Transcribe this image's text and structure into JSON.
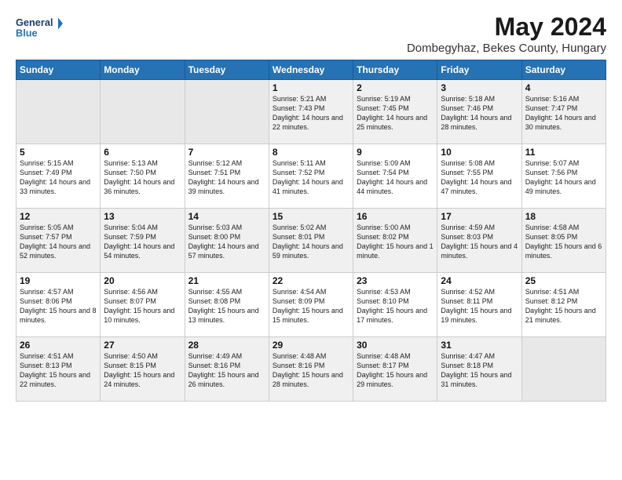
{
  "logo": {
    "line1": "General",
    "line2": "Blue"
  },
  "title": "May 2024",
  "subtitle": "Dombegyhaz, Bekes County, Hungary",
  "weekdays": [
    "Sunday",
    "Monday",
    "Tuesday",
    "Wednesday",
    "Thursday",
    "Friday",
    "Saturday"
  ],
  "weeks": [
    [
      {
        "day": "",
        "sunrise": "",
        "sunset": "",
        "daylight": ""
      },
      {
        "day": "",
        "sunrise": "",
        "sunset": "",
        "daylight": ""
      },
      {
        "day": "",
        "sunrise": "",
        "sunset": "",
        "daylight": ""
      },
      {
        "day": "1",
        "sunrise": "Sunrise: 5:21 AM",
        "sunset": "Sunset: 7:43 PM",
        "daylight": "Daylight: 14 hours and 22 minutes."
      },
      {
        "day": "2",
        "sunrise": "Sunrise: 5:19 AM",
        "sunset": "Sunset: 7:45 PM",
        "daylight": "Daylight: 14 hours and 25 minutes."
      },
      {
        "day": "3",
        "sunrise": "Sunrise: 5:18 AM",
        "sunset": "Sunset: 7:46 PM",
        "daylight": "Daylight: 14 hours and 28 minutes."
      },
      {
        "day": "4",
        "sunrise": "Sunrise: 5:16 AM",
        "sunset": "Sunset: 7:47 PM",
        "daylight": "Daylight: 14 hours and 30 minutes."
      }
    ],
    [
      {
        "day": "5",
        "sunrise": "Sunrise: 5:15 AM",
        "sunset": "Sunset: 7:49 PM",
        "daylight": "Daylight: 14 hours and 33 minutes."
      },
      {
        "day": "6",
        "sunrise": "Sunrise: 5:13 AM",
        "sunset": "Sunset: 7:50 PM",
        "daylight": "Daylight: 14 hours and 36 minutes."
      },
      {
        "day": "7",
        "sunrise": "Sunrise: 5:12 AM",
        "sunset": "Sunset: 7:51 PM",
        "daylight": "Daylight: 14 hours and 39 minutes."
      },
      {
        "day": "8",
        "sunrise": "Sunrise: 5:11 AM",
        "sunset": "Sunset: 7:52 PM",
        "daylight": "Daylight: 14 hours and 41 minutes."
      },
      {
        "day": "9",
        "sunrise": "Sunrise: 5:09 AM",
        "sunset": "Sunset: 7:54 PM",
        "daylight": "Daylight: 14 hours and 44 minutes."
      },
      {
        "day": "10",
        "sunrise": "Sunrise: 5:08 AM",
        "sunset": "Sunset: 7:55 PM",
        "daylight": "Daylight: 14 hours and 47 minutes."
      },
      {
        "day": "11",
        "sunrise": "Sunrise: 5:07 AM",
        "sunset": "Sunset: 7:56 PM",
        "daylight": "Daylight: 14 hours and 49 minutes."
      }
    ],
    [
      {
        "day": "12",
        "sunrise": "Sunrise: 5:05 AM",
        "sunset": "Sunset: 7:57 PM",
        "daylight": "Daylight: 14 hours and 52 minutes."
      },
      {
        "day": "13",
        "sunrise": "Sunrise: 5:04 AM",
        "sunset": "Sunset: 7:59 PM",
        "daylight": "Daylight: 14 hours and 54 minutes."
      },
      {
        "day": "14",
        "sunrise": "Sunrise: 5:03 AM",
        "sunset": "Sunset: 8:00 PM",
        "daylight": "Daylight: 14 hours and 57 minutes."
      },
      {
        "day": "15",
        "sunrise": "Sunrise: 5:02 AM",
        "sunset": "Sunset: 8:01 PM",
        "daylight": "Daylight: 14 hours and 59 minutes."
      },
      {
        "day": "16",
        "sunrise": "Sunrise: 5:00 AM",
        "sunset": "Sunset: 8:02 PM",
        "daylight": "Daylight: 15 hours and 1 minute."
      },
      {
        "day": "17",
        "sunrise": "Sunrise: 4:59 AM",
        "sunset": "Sunset: 8:03 PM",
        "daylight": "Daylight: 15 hours and 4 minutes."
      },
      {
        "day": "18",
        "sunrise": "Sunrise: 4:58 AM",
        "sunset": "Sunset: 8:05 PM",
        "daylight": "Daylight: 15 hours and 6 minutes."
      }
    ],
    [
      {
        "day": "19",
        "sunrise": "Sunrise: 4:57 AM",
        "sunset": "Sunset: 8:06 PM",
        "daylight": "Daylight: 15 hours and 8 minutes."
      },
      {
        "day": "20",
        "sunrise": "Sunrise: 4:56 AM",
        "sunset": "Sunset: 8:07 PM",
        "daylight": "Daylight: 15 hours and 10 minutes."
      },
      {
        "day": "21",
        "sunrise": "Sunrise: 4:55 AM",
        "sunset": "Sunset: 8:08 PM",
        "daylight": "Daylight: 15 hours and 13 minutes."
      },
      {
        "day": "22",
        "sunrise": "Sunrise: 4:54 AM",
        "sunset": "Sunset: 8:09 PM",
        "daylight": "Daylight: 15 hours and 15 minutes."
      },
      {
        "day": "23",
        "sunrise": "Sunrise: 4:53 AM",
        "sunset": "Sunset: 8:10 PM",
        "daylight": "Daylight: 15 hours and 17 minutes."
      },
      {
        "day": "24",
        "sunrise": "Sunrise: 4:52 AM",
        "sunset": "Sunset: 8:11 PM",
        "daylight": "Daylight: 15 hours and 19 minutes."
      },
      {
        "day": "25",
        "sunrise": "Sunrise: 4:51 AM",
        "sunset": "Sunset: 8:12 PM",
        "daylight": "Daylight: 15 hours and 21 minutes."
      }
    ],
    [
      {
        "day": "26",
        "sunrise": "Sunrise: 4:51 AM",
        "sunset": "Sunset: 8:13 PM",
        "daylight": "Daylight: 15 hours and 22 minutes."
      },
      {
        "day": "27",
        "sunrise": "Sunrise: 4:50 AM",
        "sunset": "Sunset: 8:15 PM",
        "daylight": "Daylight: 15 hours and 24 minutes."
      },
      {
        "day": "28",
        "sunrise": "Sunrise: 4:49 AM",
        "sunset": "Sunset: 8:16 PM",
        "daylight": "Daylight: 15 hours and 26 minutes."
      },
      {
        "day": "29",
        "sunrise": "Sunrise: 4:48 AM",
        "sunset": "Sunset: 8:16 PM",
        "daylight": "Daylight: 15 hours and 28 minutes."
      },
      {
        "day": "30",
        "sunrise": "Sunrise: 4:48 AM",
        "sunset": "Sunset: 8:17 PM",
        "daylight": "Daylight: 15 hours and 29 minutes."
      },
      {
        "day": "31",
        "sunrise": "Sunrise: 4:47 AM",
        "sunset": "Sunset: 8:18 PM",
        "daylight": "Daylight: 15 hours and 31 minutes."
      },
      {
        "day": "",
        "sunrise": "",
        "sunset": "",
        "daylight": ""
      }
    ]
  ]
}
